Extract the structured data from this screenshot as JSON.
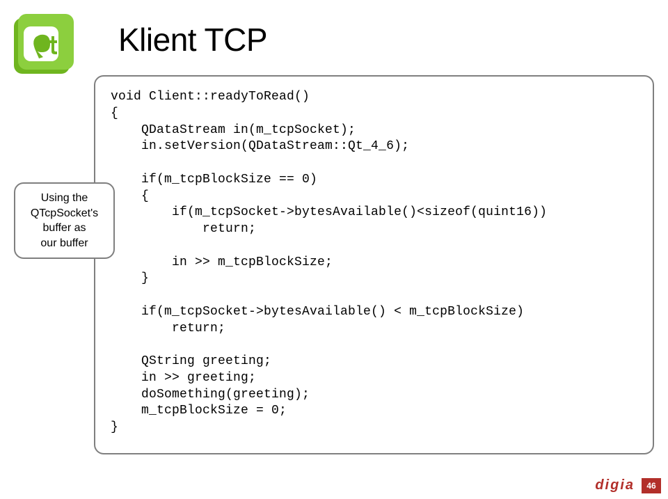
{
  "title": "Klient TCP",
  "annotation": {
    "line1": "Using the",
    "line2": "QTcpSocket's",
    "line3": "buffer as",
    "line4": "our buffer"
  },
  "code": "void Client::readyToRead()\n{\n    QDataStream in(m_tcpSocket);\n    in.setVersion(QDataStream::Qt_4_6);\n\n    if(m_tcpBlockSize == 0)\n    {\n        if(m_tcpSocket->bytesAvailable()<sizeof(quint16))\n            return;\n\n        in >> m_tcpBlockSize;\n    }\n\n    if(m_tcpSocket->bytesAvailable() < m_tcpBlockSize)\n        return;\n\n    QString greeting;\n    in >> greeting;\n    doSomething(greeting);\n    m_tcpBlockSize = 0;\n}",
  "footer": {
    "logo_text": "digia",
    "page_number": "46"
  }
}
